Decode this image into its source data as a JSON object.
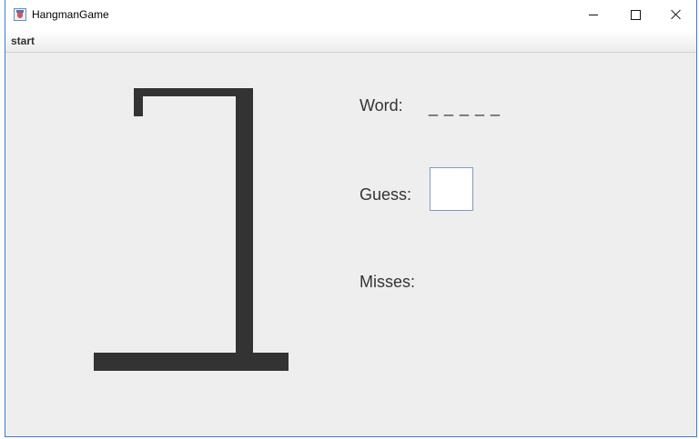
{
  "window": {
    "title": "HangmanGame",
    "icon": "java-app-icon"
  },
  "menubar": {
    "items": [
      {
        "label": "start"
      }
    ]
  },
  "game": {
    "word_label": "Word:",
    "word_value": "_ _ _ _ _",
    "guess_label": "Guess:",
    "guess_value": "",
    "misses_label": "Misses:",
    "misses_value": ""
  }
}
